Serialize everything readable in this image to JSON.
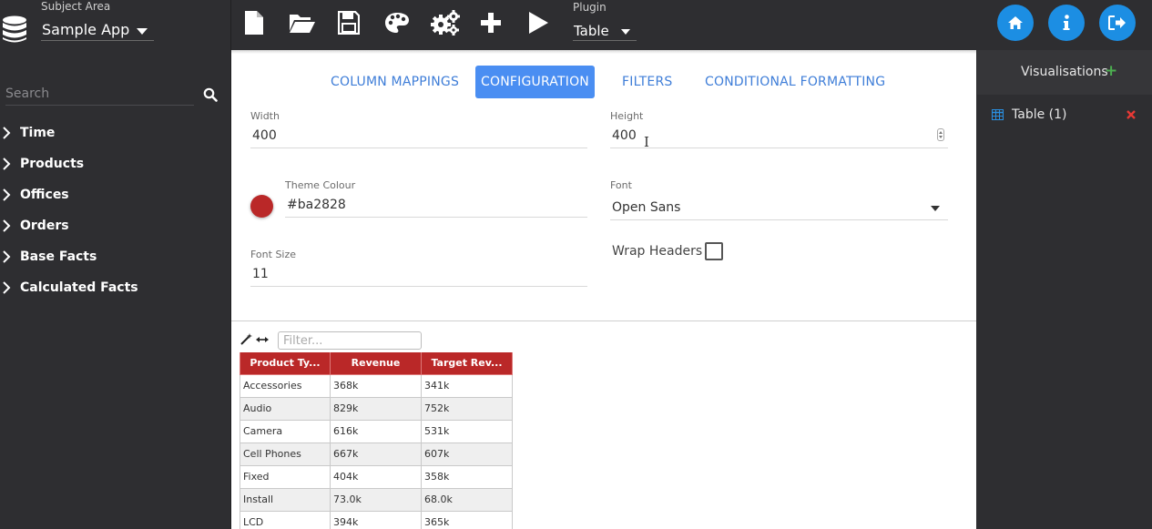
{
  "header": {
    "subject_area_label": "Subject Area",
    "subject_area_value": "Sample App",
    "plugin_label": "Plugin",
    "plugin_value": "Table",
    "toolbar_icons": [
      "new-file-icon",
      "open-folder-icon",
      "save-icon",
      "palette-icon",
      "cogs-icon",
      "plus-icon",
      "play-icon"
    ],
    "right_buttons": [
      "home-icon",
      "info-icon",
      "sign-out-icon"
    ]
  },
  "sidebar": {
    "search_placeholder": "Search",
    "items": [
      {
        "label": "Time"
      },
      {
        "label": "Products"
      },
      {
        "label": "Offices"
      },
      {
        "label": "Orders"
      },
      {
        "label": "Base Facts"
      },
      {
        "label": "Calculated Facts"
      }
    ]
  },
  "tabs": [
    {
      "label": "COLUMN MAPPINGS",
      "active": false
    },
    {
      "label": "CONFIGURATION",
      "active": true
    },
    {
      "label": "FILTERS",
      "active": false
    },
    {
      "label": "CONDITIONAL FORMATTING",
      "active": false
    }
  ],
  "config": {
    "width_label": "Width",
    "width_value": "400",
    "height_label": "Height",
    "height_value": "400",
    "theme_colour_label": "Theme Colour",
    "theme_colour_value": "#ba2828",
    "font_label": "Font",
    "font_value": "Open Sans",
    "font_size_label": "Font Size",
    "font_size_value": "11",
    "wrap_headers_label": "Wrap Headers",
    "wrap_headers_checked": false
  },
  "preview": {
    "filter_placeholder": "Filter...",
    "headers": [
      "Product Ty...",
      "Revenue",
      "Target Rev..."
    ],
    "rows": [
      [
        "Accessories",
        "368k",
        "341k"
      ],
      [
        "Audio",
        "829k",
        "752k"
      ],
      [
        "Camera",
        "616k",
        "531k"
      ],
      [
        "Cell Phones",
        "667k",
        "607k"
      ],
      [
        "Fixed",
        "404k",
        "358k"
      ],
      [
        "Install",
        "73.0k",
        "68.0k"
      ],
      [
        "LCD",
        "394k",
        "365k"
      ]
    ]
  },
  "visualisations": {
    "title": "Visualisations",
    "items": [
      {
        "label": "Table (1)"
      }
    ]
  },
  "colors": {
    "accent_blue": "#1c8ee3",
    "tab_active": "#4a8ef2",
    "theme_red": "#ba2828",
    "add_green": "#4caf50",
    "remove_red": "#e53935"
  }
}
